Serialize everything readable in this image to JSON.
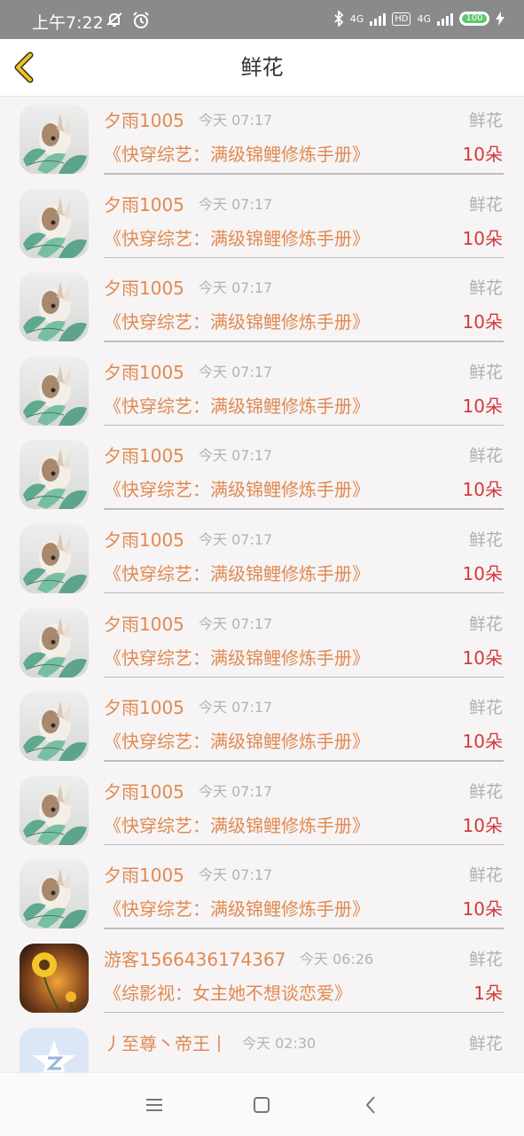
{
  "status_bar": {
    "time": "上午7:22",
    "network_1": "4G",
    "hd": "HD",
    "network_2": "4G",
    "battery": "100",
    "icons": [
      "mute-icon",
      "alarm-icon",
      "bluetooth-icon",
      "signal-icon",
      "hd-icon",
      "signal-icon",
      "battery-icon",
      "charging-icon"
    ]
  },
  "header": {
    "title": "鲜花",
    "back_icon": "chevron-left-icon"
  },
  "colors": {
    "name": "#e08a52",
    "count": "#d23a3a",
    "muted": "#b0b0b0",
    "back": "#f0c419"
  },
  "records": [
    {
      "user": "夕雨1005",
      "time": "今天 07:17",
      "gift": "鲜花",
      "book": "《快穿综艺：满级锦鲤修炼手册》",
      "count": "10朵",
      "avatar": "rabbit"
    },
    {
      "user": "夕雨1005",
      "time": "今天 07:17",
      "gift": "鲜花",
      "book": "《快穿综艺：满级锦鲤修炼手册》",
      "count": "10朵",
      "avatar": "rabbit"
    },
    {
      "user": "夕雨1005",
      "time": "今天 07:17",
      "gift": "鲜花",
      "book": "《快穿综艺：满级锦鲤修炼手册》",
      "count": "10朵",
      "avatar": "rabbit"
    },
    {
      "user": "夕雨1005",
      "time": "今天 07:17",
      "gift": "鲜花",
      "book": "《快穿综艺：满级锦鲤修炼手册》",
      "count": "10朵",
      "avatar": "rabbit"
    },
    {
      "user": "夕雨1005",
      "time": "今天 07:17",
      "gift": "鲜花",
      "book": "《快穿综艺：满级锦鲤修炼手册》",
      "count": "10朵",
      "avatar": "rabbit"
    },
    {
      "user": "夕雨1005",
      "time": "今天 07:17",
      "gift": "鲜花",
      "book": "《快穿综艺：满级锦鲤修炼手册》",
      "count": "10朵",
      "avatar": "rabbit"
    },
    {
      "user": "夕雨1005",
      "time": "今天 07:17",
      "gift": "鲜花",
      "book": "《快穿综艺：满级锦鲤修炼手册》",
      "count": "10朵",
      "avatar": "rabbit"
    },
    {
      "user": "夕雨1005",
      "time": "今天 07:17",
      "gift": "鲜花",
      "book": "《快穿综艺：满级锦鲤修炼手册》",
      "count": "10朵",
      "avatar": "rabbit"
    },
    {
      "user": "夕雨1005",
      "time": "今天 07:17",
      "gift": "鲜花",
      "book": "《快穿综艺：满级锦鲤修炼手册》",
      "count": "10朵",
      "avatar": "rabbit"
    },
    {
      "user": "夕雨1005",
      "time": "今天 07:17",
      "gift": "鲜花",
      "book": "《快穿综艺：满级锦鲤修炼手册》",
      "count": "10朵",
      "avatar": "rabbit"
    },
    {
      "user": "游客1566436174367",
      "time": "今天 06:26",
      "gift": "鲜花",
      "book": "《综影视：女主她不想谈恋爱》",
      "count": "1朵",
      "avatar": "sunflower"
    },
    {
      "user": "丿至尊丶帝王丨",
      "time": "今天 02:30",
      "gift": "鲜花",
      "book": "",
      "count": "",
      "avatar": "qq"
    }
  ],
  "nav_bar": {
    "icons": [
      "menu-icon",
      "home-square-icon",
      "back-triangle-icon"
    ]
  }
}
